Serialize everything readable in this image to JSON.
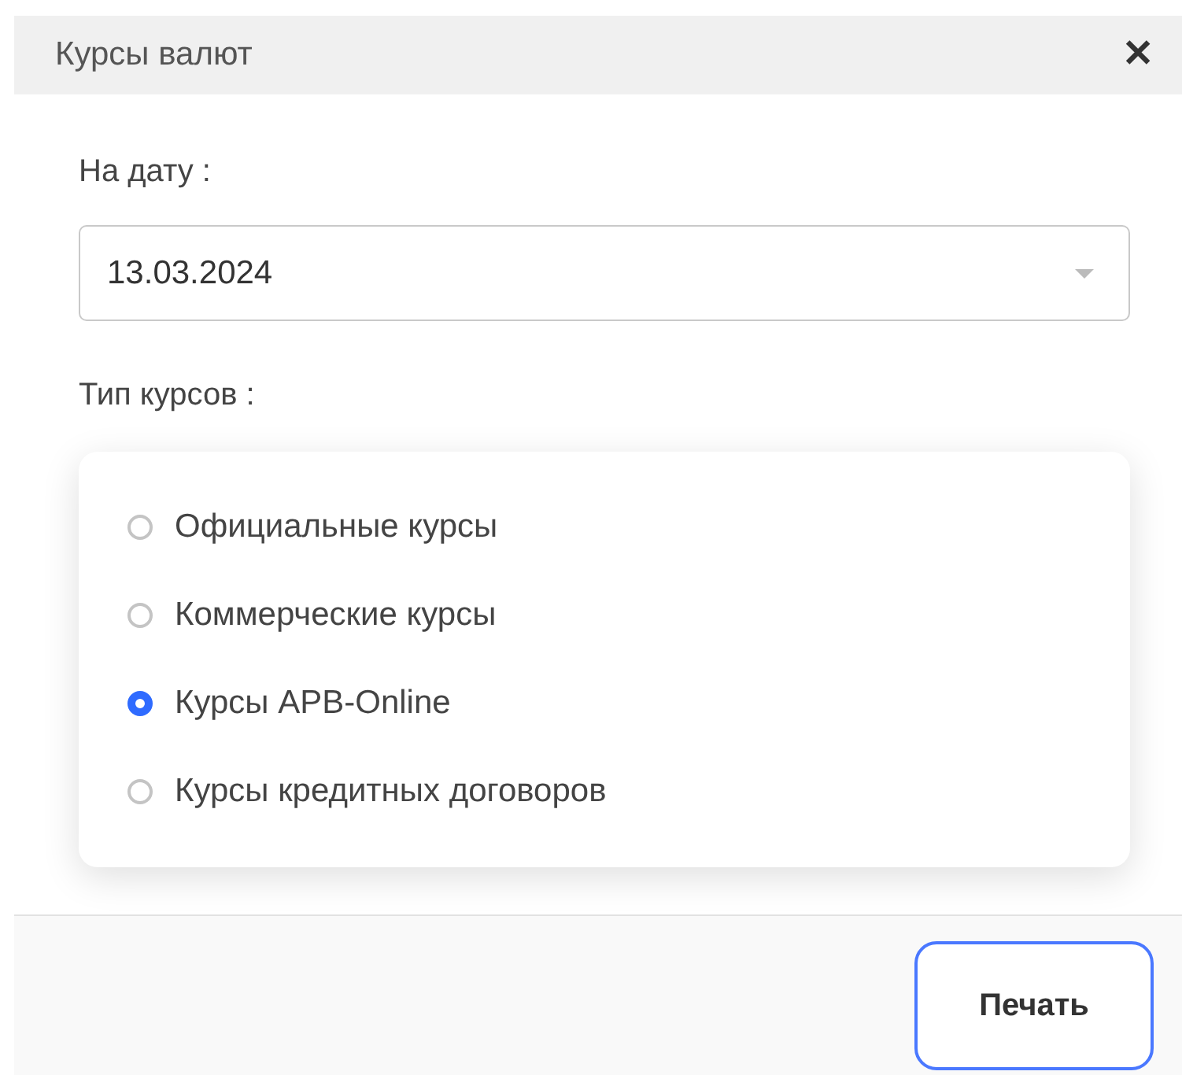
{
  "dialog": {
    "title": "Курсы валют",
    "close_icon": "✕"
  },
  "date_field": {
    "label": "На дату :",
    "value": "13.03.2024"
  },
  "rate_type": {
    "label": "Тип курсов :",
    "options": [
      {
        "label": "Официальные курсы",
        "selected": false
      },
      {
        "label": "Коммерческие курсы",
        "selected": false
      },
      {
        "label": "Курсы APB-Online",
        "selected": true
      },
      {
        "label": "Курсы кредитных договоров",
        "selected": false
      }
    ]
  },
  "buttons": [
    {
      "label": "Печать"
    }
  ]
}
